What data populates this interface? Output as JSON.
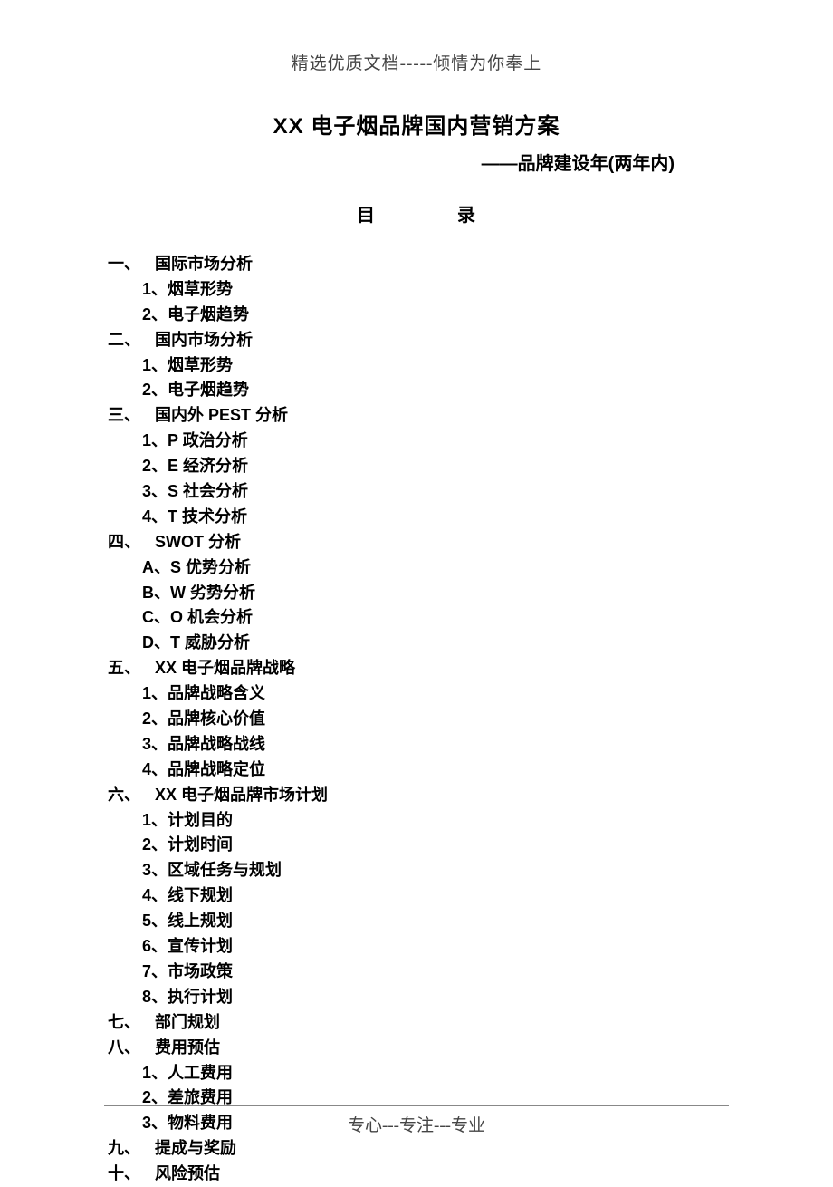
{
  "header": "精选优质文档-----倾情为你奉上",
  "title": "XX 电子烟品牌国内营销方案",
  "subtitle": "——品牌建设年(两年内)",
  "toc_label_left": "目",
  "toc_label_right": "录",
  "sections": [
    {
      "num": "一、",
      "title": "国际市场分析",
      "subs": [
        "1、烟草形势",
        "2、电子烟趋势"
      ]
    },
    {
      "num": "二、",
      "title": "国内市场分析",
      "subs": [
        "1、烟草形势",
        "2、电子烟趋势"
      ]
    },
    {
      "num": "三、",
      "title": "国内外 PEST 分析",
      "subs": [
        "1、P 政治分析",
        "2、E 经济分析",
        "3、S 社会分析",
        "4、T 技术分析"
      ]
    },
    {
      "num": "四、",
      "title": "SWOT 分析",
      "subs": [
        "A、S 优势分析",
        "B、W 劣势分析",
        "C、O 机会分析",
        "D、T 威胁分析"
      ]
    },
    {
      "num": "五、",
      "title": "XX 电子烟品牌战略",
      "subs": [
        "1、品牌战略含义",
        "2、品牌核心价值",
        "3、品牌战略战线",
        "4、品牌战略定位"
      ]
    },
    {
      "num": "六、",
      "title": "XX 电子烟品牌市场计划",
      "subs": [
        "1、计划目的",
        "2、计划时间",
        "3、区域任务与规划",
        "4、线下规划",
        "5、线上规划",
        "6、宣传计划",
        "7、市场政策",
        "8、执行计划"
      ]
    },
    {
      "num": "七、",
      "title": "部门规划",
      "subs": []
    },
    {
      "num": "八、",
      "title": "费用预估",
      "subs": [
        "1、人工费用",
        "2、差旅费用",
        "3、物料费用"
      ]
    },
    {
      "num": "九、",
      "title": "提成与奖励",
      "subs": []
    },
    {
      "num": "十、",
      "title": "风险预估",
      "subs": []
    }
  ],
  "footer": "专心---专注---专业"
}
